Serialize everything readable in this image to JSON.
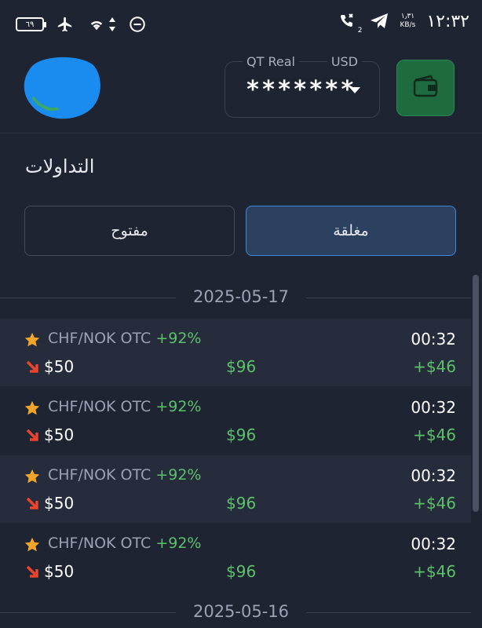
{
  "status_bar": {
    "battery": "٦٩",
    "time": "١٢:٣٢",
    "net_speed": "١٫٣١",
    "net_unit": "KB/s",
    "sim_badge": "2"
  },
  "header": {
    "account_type": "QT Real",
    "currency": "USD",
    "balance_masked": "*******"
  },
  "section_title": "التداولات",
  "tabs": {
    "closed": "مغلقة",
    "open": "مفتوح"
  },
  "groups": [
    {
      "date": "2025-05-17",
      "trades": [
        {
          "pair": "CHF/NOK OTC",
          "pct": "+92%",
          "time": "00:32",
          "amount": "$50",
          "payout": "$96",
          "profit": "+$46"
        },
        {
          "pair": "CHF/NOK OTC",
          "pct": "+92%",
          "time": "00:32",
          "amount": "$50",
          "payout": "$96",
          "profit": "+$46"
        },
        {
          "pair": "CHF/NOK OTC",
          "pct": "+92%",
          "time": "00:32",
          "amount": "$50",
          "payout": "$96",
          "profit": "+$46"
        },
        {
          "pair": "CHF/NOK OTC",
          "pct": "+92%",
          "time": "00:32",
          "amount": "$50",
          "payout": "$96",
          "profit": "+$46"
        }
      ]
    },
    {
      "date": "2025-05-16",
      "trades": []
    }
  ],
  "colors": {
    "background": "#1f2433",
    "row_alt": "#262c3c",
    "accent_blue": "#3f89d9",
    "profit_green": "#5bc26a",
    "loss_red": "#e8452c",
    "star": "#f3a52a",
    "wallet_green": "#1d6b3e"
  },
  "icons": {
    "status": [
      "battery-icon",
      "airplane-icon",
      "wifi-icon",
      "sort-arrows-icon",
      "do-not-disturb-icon",
      "missed-call-icon",
      "telegram-icon"
    ],
    "trade": [
      "star-icon",
      "arrow-down-right-icon"
    ],
    "header": [
      "wallet-icon",
      "chevron-down-icon"
    ]
  }
}
